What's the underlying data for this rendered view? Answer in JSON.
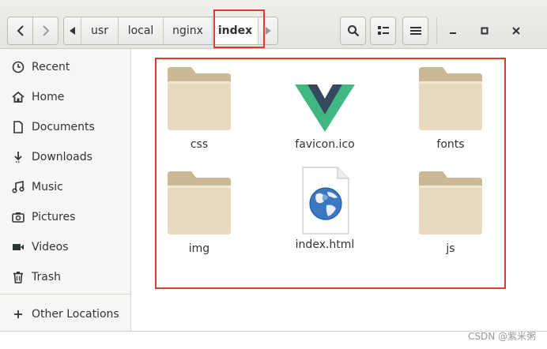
{
  "pathbar": {
    "crumbs": [
      "usr",
      "local",
      "nginx",
      "index"
    ],
    "active": "index"
  },
  "sidebar": {
    "items": [
      {
        "label": "Recent",
        "icon": "clock-icon"
      },
      {
        "label": "Home",
        "icon": "home-icon"
      },
      {
        "label": "Documents",
        "icon": "document-icon"
      },
      {
        "label": "Downloads",
        "icon": "download-icon"
      },
      {
        "label": "Music",
        "icon": "music-icon"
      },
      {
        "label": "Pictures",
        "icon": "camera-icon"
      },
      {
        "label": "Videos",
        "icon": "video-icon"
      },
      {
        "label": "Trash",
        "icon": "trash-icon"
      }
    ],
    "other": {
      "label": "Other Locations",
      "icon": "plus-icon"
    }
  },
  "files": [
    {
      "name": "css",
      "type": "folder"
    },
    {
      "name": "favicon.ico",
      "type": "vue-logo"
    },
    {
      "name": "fonts",
      "type": "folder"
    },
    {
      "name": "img",
      "type": "folder"
    },
    {
      "name": "index.html",
      "type": "html-file"
    },
    {
      "name": "js",
      "type": "folder"
    }
  ],
  "watermark": "CSDN @紫米粥",
  "colors": {
    "highlight": "#e23a2d",
    "folder": "#e9d9bf",
    "folder_tab": "#cbb996",
    "vue_green": "#41b883",
    "vue_dark": "#35495e"
  }
}
